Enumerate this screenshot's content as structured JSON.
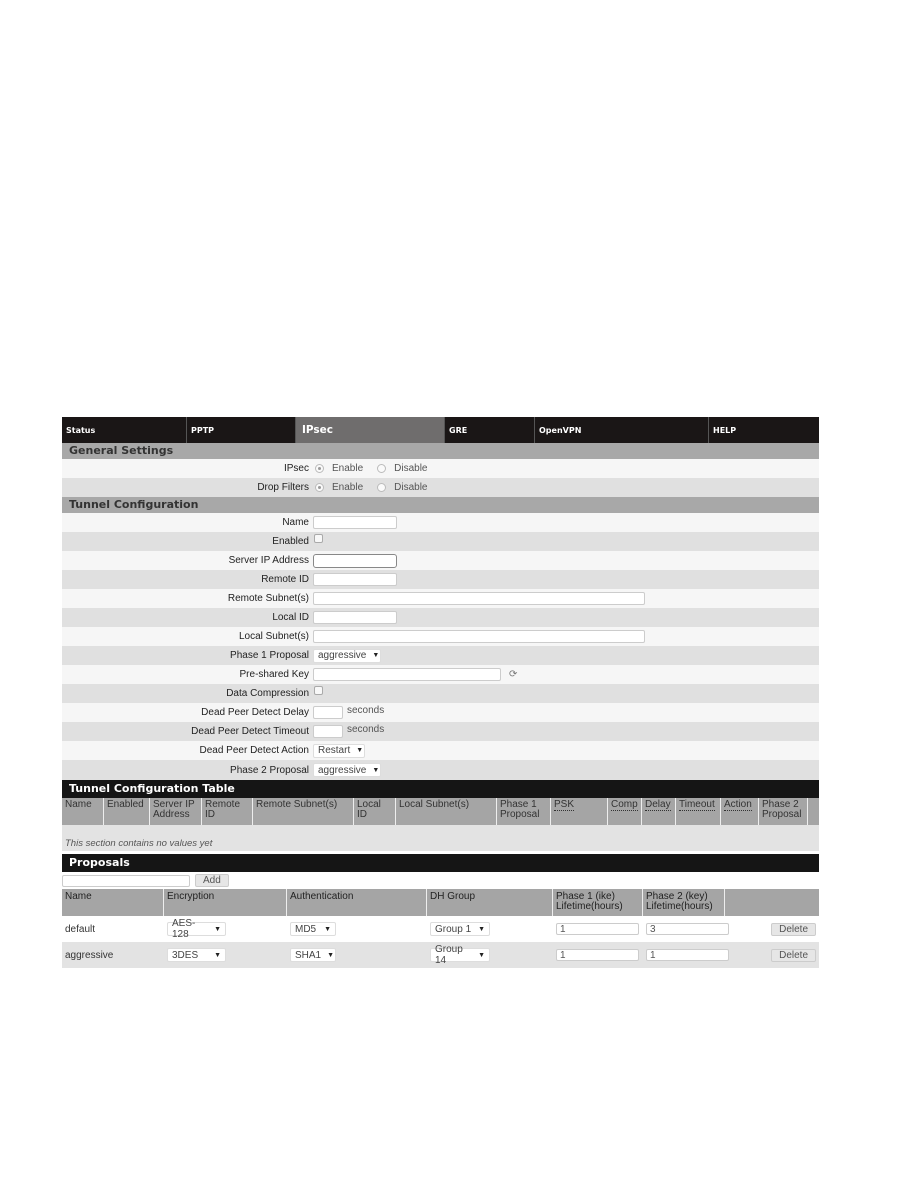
{
  "nav": {
    "tabs": [
      {
        "label": "Status",
        "active": false
      },
      {
        "label": "PPTP",
        "active": false
      },
      {
        "label": "IPsec",
        "active": true
      },
      {
        "label": "GRE",
        "active": false
      },
      {
        "label": "OpenVPN",
        "active": false
      },
      {
        "label": "HELP",
        "active": false
      }
    ]
  },
  "general": {
    "title": "General Settings",
    "ipsec": {
      "label": "IPsec",
      "options": [
        "Enable",
        "Disable"
      ],
      "selected": "Enable"
    },
    "drop_filters": {
      "label": "Drop Filters",
      "options": [
        "Enable",
        "Disable"
      ],
      "selected": "Enable"
    }
  },
  "tunnel": {
    "title": "Tunnel Configuration",
    "name": {
      "label": "Name",
      "value": ""
    },
    "enabled": {
      "label": "Enabled",
      "checked": false
    },
    "server_ip": {
      "label": "Server IP Address",
      "value": ""
    },
    "remote_id": {
      "label": "Remote ID",
      "value": ""
    },
    "remote_subnets": {
      "label": "Remote Subnet(s)",
      "value": ""
    },
    "local_id": {
      "label": "Local ID",
      "value": ""
    },
    "local_subnets": {
      "label": "Local Subnet(s)",
      "value": ""
    },
    "phase1": {
      "label": "Phase 1 Proposal",
      "value": "aggressive"
    },
    "psk": {
      "label": "Pre-shared Key",
      "value": ""
    },
    "compression": {
      "label": "Data Compression",
      "checked": false
    },
    "dpd_delay": {
      "label": "Dead Peer Detect Delay",
      "value": "",
      "unit": "seconds"
    },
    "dpd_timeout": {
      "label": "Dead Peer Detect Timeout",
      "value": "",
      "unit": "seconds"
    },
    "dpd_action": {
      "label": "Dead Peer Detect Action",
      "value": "Restart"
    },
    "phase2": {
      "label": "Phase 2 Proposal",
      "value": "aggressive"
    }
  },
  "tunnel_table": {
    "title": "Tunnel Configuration Table",
    "columns": [
      "Name",
      "Enabled",
      "Server IP Address",
      "Remote ID",
      "Remote Subnet(s)",
      "Local ID",
      "Local Subnet(s)",
      "Phase 1 Proposal",
      "PSK",
      "Comp",
      "Delay",
      "Timeout",
      "Action",
      "Phase 2 Proposal"
    ],
    "empty_text": "This section contains no values yet"
  },
  "proposals": {
    "title": "Proposals",
    "new_name": "",
    "add_label": "Add",
    "columns": [
      "Name",
      "Encryption",
      "Authentication",
      "DH Group",
      "Phase 1 (ike) Lifetime(hours)",
      "Phase 2 (key) Lifetime(hours)",
      ""
    ],
    "rows": [
      {
        "name": "default",
        "encryption": "AES-128",
        "authentication": "MD5",
        "dh_group": "Group 1",
        "phase1_lifetime": "1",
        "phase2_lifetime": "3",
        "delete_label": "Delete"
      },
      {
        "name": "aggressive",
        "encryption": "3DES",
        "authentication": "SHA1",
        "dh_group": "Group 14",
        "phase1_lifetime": "1",
        "phase2_lifetime": "1",
        "delete_label": "Delete"
      }
    ]
  }
}
